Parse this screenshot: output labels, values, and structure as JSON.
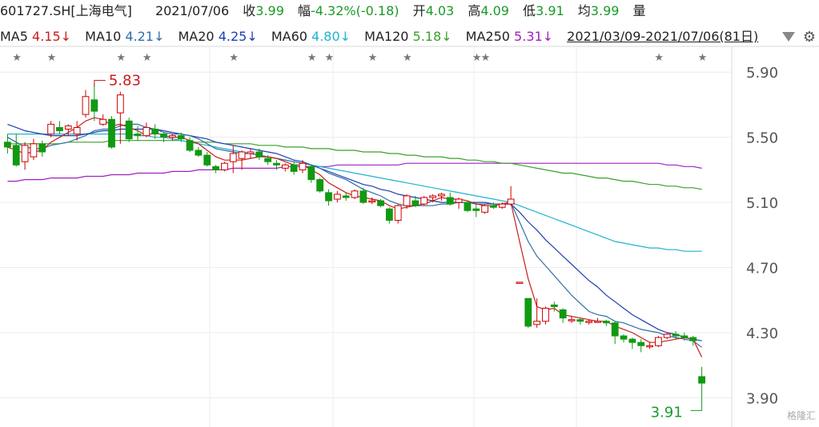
{
  "header": {
    "code_name": "601727.SH[上海电气]",
    "date": "2021/07/06",
    "close_label": "收",
    "close": "3.99",
    "change_label": "幅",
    "change": "-4.32%(-0.18)",
    "open_label": "开",
    "open": "4.03",
    "high_label": "高",
    "high": "4.09",
    "low_label": "低",
    "low": "3.91",
    "avg_label": "均",
    "avg": "3.99",
    "vol_label": "量"
  },
  "ma_bar": {
    "ma5_label": "MA5",
    "ma5": "4.15↓",
    "ma10_label": "MA10",
    "ma10": "4.21↓",
    "ma20_label": "MA20",
    "ma20": "4.25↓",
    "ma60_label": "MA60",
    "ma60": "4.80↓",
    "ma120_label": "MA120",
    "ma120": "5.18↓",
    "ma250_label": "MA250",
    "ma250": "5.31↓",
    "range": "2021/03/09-2021/07/06(81日)"
  },
  "watermark": "格隆汇",
  "chart_data": {
    "type": "candlestick",
    "ylim": [
      3.75,
      5.96
    ],
    "y_ticks": [
      "5.90",
      "5.50",
      "5.10",
      "4.70",
      "4.30",
      "3.90"
    ],
    "x_count": 81,
    "colors": {
      "up": "#d00000",
      "down": "#119911",
      "ma5": "#c81e1e",
      "ma10": "#2e6fa8",
      "ma20": "#1f3fb0",
      "ma60": "#20b2d2",
      "ma120": "#3aa02a",
      "ma250": "#a020c0"
    },
    "annotations": [
      {
        "text": "5.83",
        "index": 10,
        "value": 5.83,
        "color": "#c81e1e"
      },
      {
        "text": "3.91",
        "index": 80,
        "value": 3.91,
        "color": "#1a9a2a"
      }
    ],
    "star_indices": [
      1,
      5,
      13,
      16,
      26,
      35,
      37,
      42,
      46,
      54,
      55,
      75,
      80
    ],
    "candles": [
      [
        5.47,
        5.44,
        5.52,
        5.4
      ],
      [
        5.45,
        5.33,
        5.52,
        5.32
      ],
      [
        5.35,
        5.45,
        5.47,
        5.3
      ],
      [
        5.38,
        5.46,
        5.49,
        5.36
      ],
      [
        5.46,
        5.41,
        5.48,
        5.38
      ],
      [
        5.52,
        5.58,
        5.6,
        5.5
      ],
      [
        5.56,
        5.54,
        5.6,
        5.52
      ],
      [
        5.55,
        5.57,
        5.58,
        5.51
      ],
      [
        5.52,
        5.56,
        5.6,
        5.48
      ],
      [
        5.64,
        5.75,
        5.79,
        5.62
      ],
      [
        5.73,
        5.66,
        5.83,
        5.6
      ],
      [
        5.58,
        5.61,
        5.64,
        5.57
      ],
      [
        5.61,
        5.44,
        5.63,
        5.43
      ],
      [
        5.65,
        5.76,
        5.78,
        5.46
      ],
      [
        5.6,
        5.49,
        5.62,
        5.47
      ],
      [
        5.52,
        5.51,
        5.57,
        5.48
      ],
      [
        5.51,
        5.56,
        5.59,
        5.5
      ],
      [
        5.55,
        5.52,
        5.58,
        5.49
      ],
      [
        5.52,
        5.5,
        5.53,
        5.47
      ],
      [
        5.5,
        5.51,
        5.52,
        5.48
      ],
      [
        5.51,
        5.49,
        5.53,
        5.47
      ],
      [
        5.48,
        5.42,
        5.5,
        5.41
      ],
      [
        5.42,
        5.39,
        5.44,
        5.38
      ],
      [
        5.39,
        5.33,
        5.41,
        5.32
      ],
      [
        5.32,
        5.3,
        5.33,
        5.28
      ],
      [
        5.3,
        5.34,
        5.35,
        5.29
      ],
      [
        5.35,
        5.4,
        5.45,
        5.28
      ],
      [
        5.37,
        5.41,
        5.42,
        5.3
      ],
      [
        5.4,
        5.41,
        5.43,
        5.37
      ],
      [
        5.41,
        5.38,
        5.43,
        5.36
      ],
      [
        5.37,
        5.35,
        5.39,
        5.33
      ],
      [
        5.34,
        5.33,
        5.36,
        5.3
      ],
      [
        5.31,
        5.33,
        5.34,
        5.29
      ],
      [
        5.33,
        5.29,
        5.35,
        5.27
      ],
      [
        5.3,
        5.34,
        5.36,
        5.28
      ],
      [
        5.32,
        5.24,
        5.33,
        5.22
      ],
      [
        5.24,
        5.17,
        5.25,
        5.16
      ],
      [
        5.16,
        5.11,
        5.18,
        5.08
      ],
      [
        5.12,
        5.15,
        5.17,
        5.1
      ],
      [
        5.14,
        5.13,
        5.16,
        5.11
      ],
      [
        5.13,
        5.17,
        5.18,
        5.12
      ],
      [
        5.17,
        5.1,
        5.19,
        5.09
      ],
      [
        5.11,
        5.11,
        5.13,
        5.09
      ],
      [
        5.11,
        5.08,
        5.12,
        5.07
      ],
      [
        5.06,
        4.99,
        5.07,
        4.97
      ],
      [
        4.99,
        5.08,
        5.09,
        4.97
      ],
      [
        5.08,
        5.14,
        5.15,
        5.06
      ],
      [
        5.11,
        5.08,
        5.14,
        5.07
      ],
      [
        5.09,
        5.13,
        5.14,
        5.08
      ],
      [
        5.13,
        5.14,
        5.15,
        5.1
      ],
      [
        5.14,
        5.15,
        5.16,
        5.11
      ],
      [
        5.13,
        5.09,
        5.16,
        5.08
      ],
      [
        5.1,
        5.12,
        5.13,
        5.06
      ],
      [
        5.1,
        5.05,
        5.11,
        5.04
      ],
      [
        5.06,
        5.05,
        5.1,
        5.01
      ],
      [
        5.04,
        5.08,
        5.09,
        5.03
      ],
      [
        5.08,
        5.07,
        5.1,
        5.06
      ],
      [
        5.07,
        5.09,
        5.1,
        5.06
      ],
      [
        5.09,
        5.12,
        5.2,
        5.08
      ],
      [
        4.61,
        4.61,
        4.61,
        4.61
      ],
      [
        4.51,
        4.34,
        4.51,
        4.33
      ],
      [
        4.35,
        4.37,
        4.51,
        4.33
      ],
      [
        4.37,
        4.45,
        4.46,
        4.35
      ],
      [
        4.47,
        4.46,
        4.49,
        4.43
      ],
      [
        4.44,
        4.39,
        4.45,
        4.36
      ],
      [
        4.38,
        4.38,
        4.4,
        4.36
      ],
      [
        4.38,
        4.37,
        4.39,
        4.35
      ],
      [
        4.37,
        4.37,
        4.38,
        4.35
      ],
      [
        4.37,
        4.37,
        4.39,
        4.36
      ],
      [
        4.37,
        4.36,
        4.38,
        4.34
      ],
      [
        4.36,
        4.28,
        4.37,
        4.23
      ],
      [
        4.28,
        4.26,
        4.29,
        4.24
      ],
      [
        4.26,
        4.24,
        4.27,
        4.2
      ],
      [
        4.24,
        4.22,
        4.26,
        4.18
      ],
      [
        4.22,
        4.22,
        4.24,
        4.2
      ],
      [
        4.22,
        4.27,
        4.28,
        4.21
      ],
      [
        4.27,
        4.29,
        4.3,
        4.26
      ],
      [
        4.29,
        4.28,
        4.31,
        4.26
      ],
      [
        4.28,
        4.27,
        4.3,
        4.25
      ],
      [
        4.27,
        4.25,
        4.28,
        4.22
      ],
      [
        4.03,
        3.99,
        4.09,
        3.91
      ]
    ],
    "ma_lines": {
      "ma5": [
        5.44,
        5.42,
        5.4,
        5.41,
        5.42,
        5.47,
        5.5,
        5.53,
        5.56,
        5.6,
        5.62,
        5.61,
        5.57,
        5.58,
        5.56,
        5.54,
        5.51,
        5.53,
        5.51,
        5.5,
        5.5,
        5.48,
        5.46,
        5.42,
        5.38,
        5.36,
        5.36,
        5.36,
        5.37,
        5.38,
        5.38,
        5.37,
        5.35,
        5.33,
        5.33,
        5.3,
        5.27,
        5.22,
        5.19,
        5.16,
        5.14,
        5.13,
        5.12,
        5.11,
        5.08,
        5.06,
        5.07,
        5.08,
        5.09,
        5.11,
        5.13,
        5.12,
        5.12,
        5.11,
        5.09,
        5.08,
        5.08,
        5.09,
        5.1,
        4.86,
        4.63,
        4.46,
        4.44,
        4.45,
        4.41,
        4.4,
        4.39,
        4.38,
        4.37,
        4.37,
        4.34,
        4.32,
        4.3,
        4.27,
        4.24,
        4.24,
        4.25,
        4.26,
        4.27,
        4.26,
        4.15
      ],
      "ma10": [
        5.5,
        5.47,
        5.44,
        5.43,
        5.43,
        5.45,
        5.46,
        5.47,
        5.49,
        5.51,
        5.54,
        5.55,
        5.55,
        5.57,
        5.58,
        5.58,
        5.56,
        5.55,
        5.53,
        5.52,
        5.52,
        5.51,
        5.49,
        5.46,
        5.43,
        5.42,
        5.41,
        5.4,
        5.4,
        5.39,
        5.38,
        5.37,
        5.36,
        5.35,
        5.34,
        5.33,
        5.31,
        5.28,
        5.26,
        5.24,
        5.21,
        5.18,
        5.16,
        5.14,
        5.11,
        5.09,
        5.08,
        5.08,
        5.08,
        5.08,
        5.09,
        5.09,
        5.1,
        5.1,
        5.09,
        5.09,
        5.09,
        5.09,
        5.1,
        4.98,
        4.86,
        4.77,
        4.71,
        4.65,
        4.59,
        4.53,
        4.48,
        4.43,
        4.41,
        4.4,
        4.37,
        4.36,
        4.34,
        4.32,
        4.31,
        4.3,
        4.28,
        4.27,
        4.26,
        4.25,
        4.21
      ],
      "ma20": [
        5.58,
        5.56,
        5.54,
        5.53,
        5.52,
        5.51,
        5.51,
        5.51,
        5.51,
        5.52,
        5.53,
        5.54,
        5.54,
        5.55,
        5.55,
        5.55,
        5.55,
        5.55,
        5.54,
        5.53,
        5.52,
        5.51,
        5.5,
        5.49,
        5.47,
        5.46,
        5.45,
        5.44,
        5.43,
        5.42,
        5.41,
        5.4,
        5.38,
        5.36,
        5.35,
        5.33,
        5.31,
        5.29,
        5.27,
        5.25,
        5.23,
        5.21,
        5.2,
        5.18,
        5.17,
        5.15,
        5.14,
        5.13,
        5.12,
        5.11,
        5.1,
        5.1,
        5.1,
        5.1,
        5.1,
        5.1,
        5.09,
        5.09,
        5.09,
        5.04,
        4.98,
        4.93,
        4.87,
        4.82,
        4.77,
        4.72,
        4.67,
        4.62,
        4.58,
        4.53,
        4.49,
        4.45,
        4.41,
        4.38,
        4.35,
        4.32,
        4.3,
        4.29,
        4.27,
        4.26,
        4.25
      ],
      "ma60": [
        5.52,
        5.52,
        5.52,
        5.52,
        5.52,
        5.52,
        5.52,
        5.52,
        5.52,
        5.52,
        5.52,
        5.52,
        5.52,
        5.52,
        5.52,
        5.51,
        5.51,
        5.5,
        5.5,
        5.49,
        5.48,
        5.47,
        5.46,
        5.45,
        5.44,
        5.43,
        5.42,
        5.41,
        5.4,
        5.39,
        5.38,
        5.37,
        5.36,
        5.35,
        5.34,
        5.33,
        5.32,
        5.31,
        5.3,
        5.29,
        5.28,
        5.27,
        5.26,
        5.25,
        5.24,
        5.23,
        5.22,
        5.21,
        5.2,
        5.19,
        5.18,
        5.17,
        5.16,
        5.15,
        5.14,
        5.13,
        5.12,
        5.11,
        5.1,
        5.08,
        5.06,
        5.04,
        5.02,
        5.0,
        4.98,
        4.96,
        4.94,
        4.92,
        4.9,
        4.88,
        4.86,
        4.85,
        4.84,
        4.83,
        4.82,
        4.82,
        4.81,
        4.81,
        4.8,
        4.8,
        4.8
      ],
      "ma120": [
        5.46,
        5.46,
        5.46,
        5.46,
        5.46,
        5.46,
        5.46,
        5.47,
        5.47,
        5.47,
        5.47,
        5.47,
        5.48,
        5.48,
        5.48,
        5.48,
        5.48,
        5.48,
        5.48,
        5.48,
        5.48,
        5.47,
        5.47,
        5.47,
        5.47,
        5.46,
        5.46,
        5.46,
        5.46,
        5.45,
        5.45,
        5.45,
        5.44,
        5.44,
        5.44,
        5.43,
        5.43,
        5.43,
        5.42,
        5.42,
        5.42,
        5.41,
        5.41,
        5.41,
        5.4,
        5.4,
        5.39,
        5.39,
        5.38,
        5.38,
        5.38,
        5.37,
        5.37,
        5.36,
        5.36,
        5.35,
        5.35,
        5.34,
        5.34,
        5.33,
        5.32,
        5.31,
        5.3,
        5.29,
        5.28,
        5.28,
        5.27,
        5.26,
        5.25,
        5.25,
        5.24,
        5.23,
        5.23,
        5.22,
        5.21,
        5.21,
        5.2,
        5.2,
        5.19,
        5.19,
        5.18
      ],
      "ma250": [
        5.23,
        5.23,
        5.24,
        5.24,
        5.24,
        5.25,
        5.25,
        5.25,
        5.25,
        5.26,
        5.26,
        5.26,
        5.27,
        5.27,
        5.27,
        5.28,
        5.28,
        5.28,
        5.28,
        5.29,
        5.29,
        5.29,
        5.3,
        5.3,
        5.3,
        5.3,
        5.31,
        5.31,
        5.31,
        5.31,
        5.31,
        5.31,
        5.32,
        5.32,
        5.32,
        5.32,
        5.32,
        5.32,
        5.33,
        5.33,
        5.33,
        5.33,
        5.33,
        5.33,
        5.33,
        5.33,
        5.34,
        5.34,
        5.34,
        5.34,
        5.34,
        5.34,
        5.34,
        5.34,
        5.34,
        5.34,
        5.34,
        5.34,
        5.34,
        5.34,
        5.34,
        5.34,
        5.34,
        5.34,
        5.34,
        5.34,
        5.34,
        5.34,
        5.34,
        5.34,
        5.34,
        5.34,
        5.34,
        5.34,
        5.34,
        5.34,
        5.33,
        5.33,
        5.32,
        5.32,
        5.31
      ]
    }
  }
}
